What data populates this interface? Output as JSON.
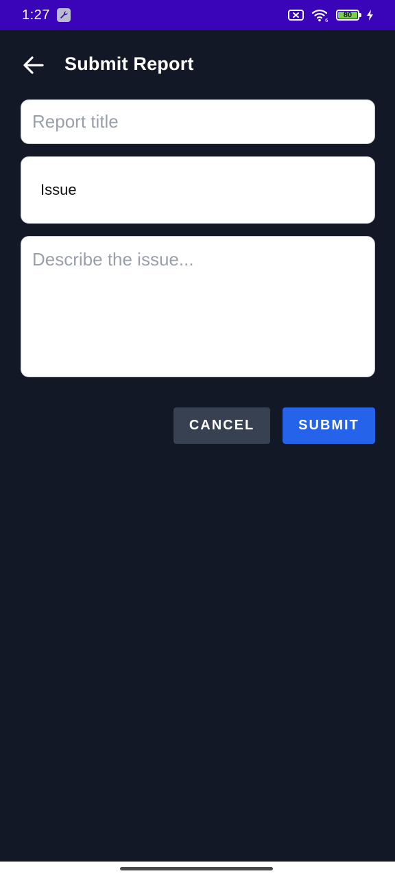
{
  "status_bar": {
    "time": "1:27",
    "battery_level": "80",
    "icons": [
      "wrench-icon",
      "sim-x-icon",
      "wifi-icon",
      "battery-icon",
      "bolt-icon"
    ]
  },
  "header": {
    "back_icon": "arrow-left-icon",
    "title": "Submit Report"
  },
  "form": {
    "title_field": {
      "value": "",
      "placeholder": "Report title"
    },
    "type_field": {
      "value": "Issue"
    },
    "description_field": {
      "value": "",
      "placeholder": "Describe the issue..."
    }
  },
  "actions": {
    "cancel_label": "CANCEL",
    "submit_label": "SUBMIT"
  },
  "colors": {
    "background": "#131827",
    "status_bar": "#3a04b8",
    "submit_button": "#2563eb",
    "cancel_button": "#374151",
    "battery": "#7ad14b"
  }
}
